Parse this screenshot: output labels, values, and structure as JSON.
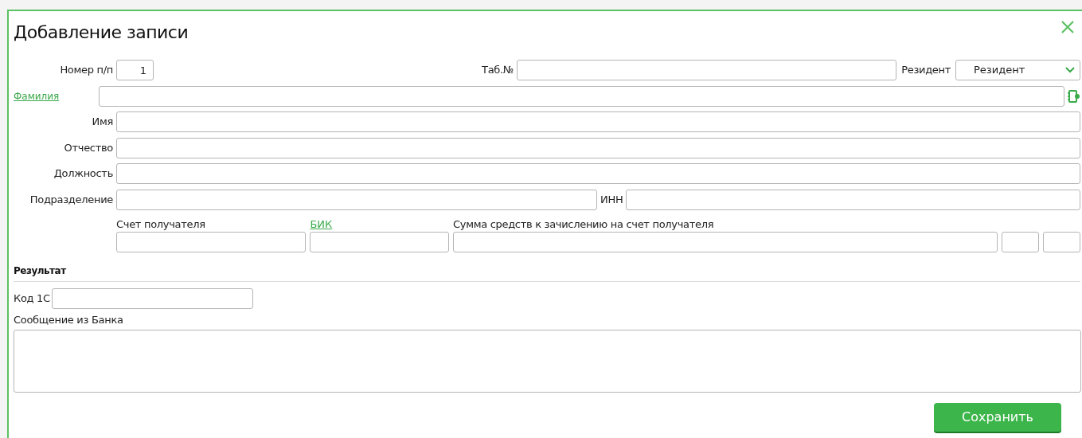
{
  "title": "Добавление записи",
  "number": {
    "label": "Номер п/п",
    "value": "1"
  },
  "tab_number": {
    "label": "Таб.№"
  },
  "resident": {
    "label": "Резидент",
    "value": "Резидент"
  },
  "surname": {
    "label": "Фамилия"
  },
  "person_fields": [
    {
      "label": "Имя"
    },
    {
      "label": "Отчество"
    },
    {
      "label": "Должность"
    }
  ],
  "department": {
    "label": "Подразделение"
  },
  "inn": {
    "label": "ИНН"
  },
  "account": {
    "label": "Счет получателя"
  },
  "bik": {
    "label": "БИК"
  },
  "amount": {
    "label": "Сумма средств к зачислению на счет получателя"
  },
  "result": {
    "title": "Результат",
    "code_label": "Код 1С",
    "message_label": "Сообщение из Банка"
  },
  "save_button": "Сохранить"
}
